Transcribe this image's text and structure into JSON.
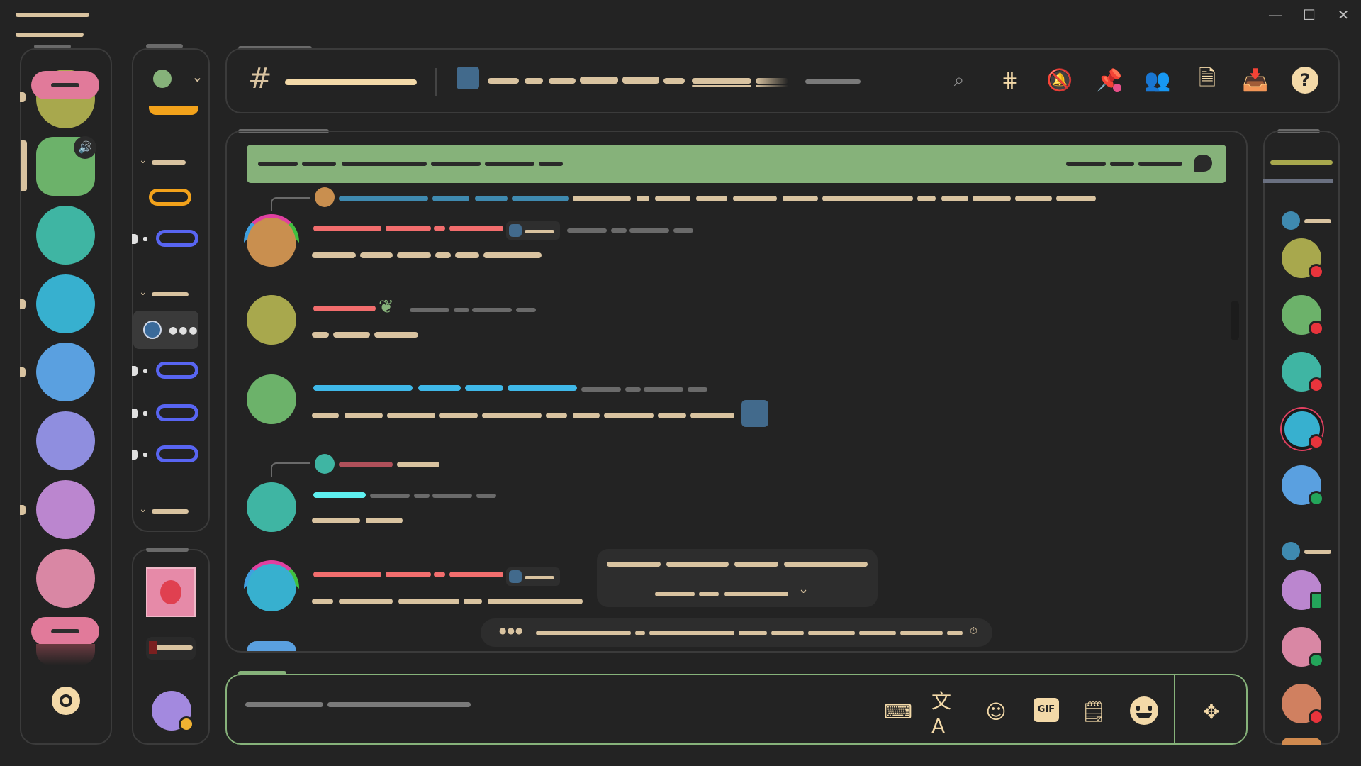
{
  "window_controls": {
    "minimize": "—",
    "maximize": "☐",
    "close": "✕"
  },
  "header": {
    "channel_hash": "#"
  },
  "composer": {
    "gif_label": "GIF"
  },
  "colors": {
    "background": "#232323",
    "panel_border": "#3b3b3b",
    "accent_green": "#86b27a",
    "text_tan": "#d9c3a0",
    "blurple": "#5865f2",
    "orange": "#f2a21b",
    "status_dnd": "#e8343c",
    "status_online": "#23a55a"
  },
  "icons": {
    "header": [
      "search-icon",
      "threads-icon",
      "mute-bell-icon",
      "pin-icon",
      "members-icon",
      "notes-icon",
      "inbox-icon",
      "help-icon"
    ],
    "composer": [
      "keyboard-icon",
      "translate-icon",
      "anime-avatar-icon",
      "gif-icon",
      "sticker-icon",
      "emoji-icon",
      "apps-icon"
    ]
  }
}
